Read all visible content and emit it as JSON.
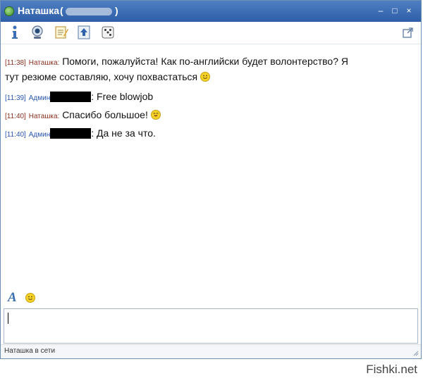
{
  "window": {
    "title_prefix": "Наташка",
    "title_open_paren": "(",
    "title_close_paren": ")",
    "minimize_label": "–",
    "maximize_label": "□",
    "close_label": "×"
  },
  "toolbar": {
    "buttons": [
      {
        "icon": "info-icon"
      },
      {
        "icon": "webcam-icon"
      },
      {
        "icon": "notes-icon"
      },
      {
        "icon": "upload-icon"
      },
      {
        "icon": "dice-icon"
      }
    ],
    "popout_icon": "popout-icon"
  },
  "messages": [
    {
      "time": "[11:38]",
      "nick": "Наташка:",
      "text_line1": "Помоги, пожалуйста! Как по-английски будет волонтерство? Я",
      "text_line2": "тут резюме составляю, хочу похвастаться",
      "emoticon": "smile-icon"
    },
    {
      "time": "[11:39]",
      "nick": "Админ",
      "after_redact": ":",
      "text": "Free blowjob"
    },
    {
      "time": "[11:40]",
      "nick": "Наташка:",
      "text": "Спасибо большое!",
      "emoticon": "grin-icon"
    },
    {
      "time": "[11:40]",
      "nick": "Админ",
      "after_redact": ":",
      "text": "Да не за что."
    }
  ],
  "input_toolbar": {
    "font_label": "A",
    "emoticon_icon": "smile-icon"
  },
  "input": {
    "value": ""
  },
  "status": {
    "text": "Наташка в сети"
  },
  "watermark": "Fishki.net",
  "colors": {
    "titlebar": "#3a6bb3",
    "nick_user": "#8b2f1f",
    "nick_admin": "#2a56b0"
  }
}
